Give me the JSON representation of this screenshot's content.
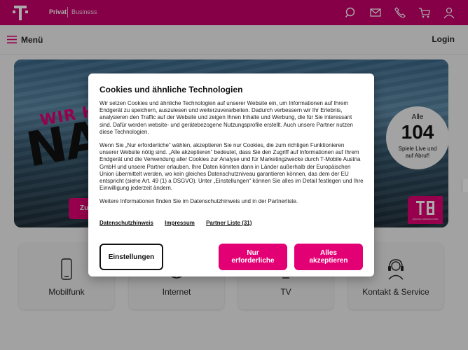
{
  "header": {
    "segment_private": "Privat",
    "segment_business": "Business",
    "icons": [
      "search-icon",
      "mail-icon",
      "phone-icon",
      "cart-icon",
      "user-icon"
    ]
  },
  "menubar": {
    "menu_label": "Menü",
    "login_label": "Login"
  },
  "hero": {
    "headline_small": "WIR HOLEN D",
    "headline_big": "NA",
    "cta_label": "Zu",
    "promo_top": "Alle",
    "promo_number": "104",
    "promo_sub_line1": "Spiele Live und",
    "promo_sub_line2": "auf Abruf!",
    "badge_caption": "OFFICIAL BROADCASTER"
  },
  "categories": [
    {
      "label": "Mobilfunk",
      "icon": "smartphone-icon"
    },
    {
      "label": "Internet",
      "icon": "globe-icon"
    },
    {
      "label": "TV",
      "icon": "tv-icon"
    },
    {
      "label": "Kontakt & Service",
      "icon": "headset-icon"
    }
  ],
  "cookie_dialog": {
    "title": "Cookies und ähnliche Technologien",
    "paragraph1": "Wir setzen Cookies und ähnliche Technologien auf unserer Website ein, um Informationen auf Ihrem Endgerät zu speichern, auszulesen und weiterzuverarbeiten. Dadurch verbessern wir Ihr Erlebnis, analysieren den Traffic auf der Website und zeigen Ihnen Inhalte und Werbung, die für Sie interessant sind. Dafür werden website- und gerätebezogene Nutzungsprofile erstellt. Auch unsere Partner nutzen diese Technologien.",
    "paragraph2": "Wenn Sie „Nur erforderliche“ wählen, akzeptieren Sie nur Cookies, die zum richtigen Funktionieren unserer Website nötig sind. „Alle akzeptieren“ bedeutet, dass Sie den Zugriff auf Informationen auf Ihrem Endgerät und die Verwendung aller Cookies zur Analyse und für Marketingzwecke durch T-Mobile Austria GmbH und unsere Partner erlauben. Ihre Daten könnten dann in Länder außerhalb der Europäischen Union übermittelt werden, wo kein gleiches Datenschutzniveau garantieren können, das dem der EU entspricht (siehe Art. 49 (1) a DSGVO). Unter „Einstellungen“ können Sie alles im Detail festlegen und Ihre Einwilligung jederzeit ändern.",
    "paragraph3": "Weitere Informationen finden Sie im Datenschutzhinweis und in der Partnerliste.",
    "links": {
      "privacy": "Datenschutzhinweis",
      "imprint": "Impressum",
      "partners": "Partner Liste (31)"
    },
    "buttons": {
      "settings": "Einstellungen",
      "required_line1": "Nur",
      "required_line2": "erforderliche",
      "accept_line1": "Alles",
      "accept_line2": "akzeptieren"
    }
  },
  "colors": {
    "brand": "#e20074",
    "topbar": "#c8006c"
  }
}
